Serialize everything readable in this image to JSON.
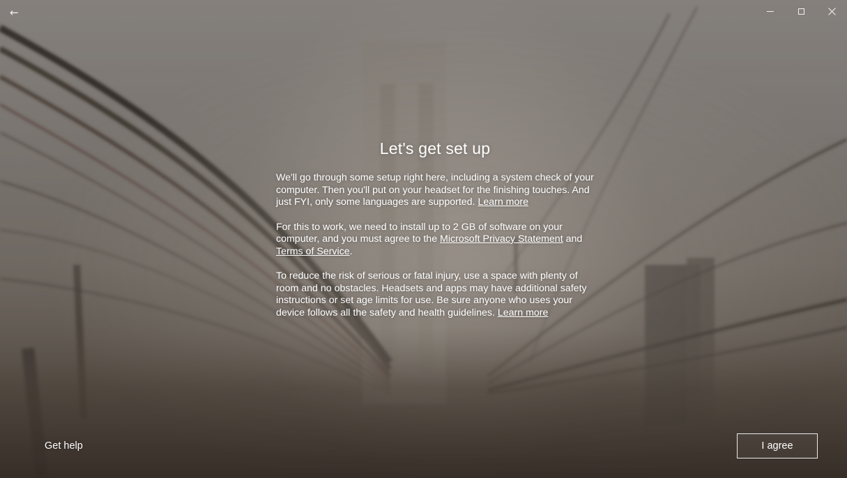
{
  "titlebar": {
    "back_icon": "←",
    "minimize_icon": "minimize-icon",
    "maximize_icon": "maximize-icon",
    "close_icon": "close-icon"
  },
  "main": {
    "title": "Let's get set up",
    "para1": {
      "text": "We'll go through some setup right here, including a system check of your computer. Then you'll put on your headset for the finishing touches. And just FYI, only some languages are supported. ",
      "link": "Learn more"
    },
    "para2": {
      "text_before": "For this to work, we need to install up to 2 GB of software on your computer, and you must agree to the ",
      "link_privacy": "Microsoft Privacy Statement",
      "text_and": " and ",
      "link_terms": "Terms of Service",
      "text_end": "."
    },
    "para3": {
      "text": "To reduce the risk of serious or fatal injury, use a space with plenty of room and no obstacles. Headsets and apps may have additional safety instructions or set age limits for use. Be sure anyone who uses your device follows all the safety and health guidelines. ",
      "link": "Learn more"
    }
  },
  "footer": {
    "get_help": "Get help",
    "agree": "I agree"
  }
}
